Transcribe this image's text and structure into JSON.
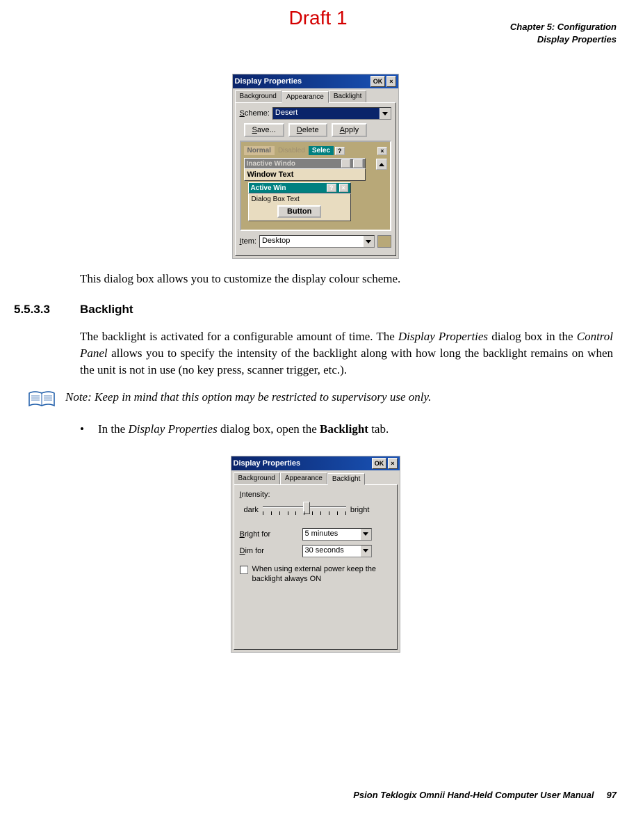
{
  "watermark": "Draft 1",
  "header": {
    "chapter": "Chapter 5: Configuration",
    "section": "Display Properties"
  },
  "shot1": {
    "title": "Display Properties",
    "ok": "OK",
    "close": "×",
    "tabs": {
      "bg": "Background",
      "app": "Appearance",
      "bl": "Backlight"
    },
    "scheme_lbl": "Scheme:",
    "scheme_val": "Desert",
    "btn_save": "Save...",
    "btn_delete": "Delete",
    "btn_apply": "Apply",
    "preview": {
      "normal": "Normal",
      "disabled": "Disabled",
      "selected": "Selec",
      "q": "?",
      "x": "×",
      "inactive": "Inactive Windo",
      "wintext": "Window Text",
      "active": "Active Win",
      "dlg": "Dialog Box Text",
      "button": "Button"
    },
    "item_lbl": "Item:",
    "item_val": "Desktop"
  },
  "para1": "This dialog box allows you to customize the display colour scheme.",
  "heading": {
    "num": "5.5.3.3",
    "title": "Backlight"
  },
  "para2_a": "The backlight is activated for a configurable amount of time. The ",
  "para2_b": "Display Properties",
  "para2_c": " dialog box in the ",
  "para2_d": "Control Panel",
  "para2_e": " allows you to specify the intensity of the backlight along with how long the backlight remains on when the unit is not in use (no key press, scanner trigger, etc.).",
  "note_prefix": "Note:",
  "note_text": " Keep in mind that this option may be restricted to supervisory use only.",
  "bullet_a": "In the ",
  "bullet_b": "Display Properties",
  "bullet_c": " dialog box, open the ",
  "bullet_d": "Backlight",
  "bullet_e": " tab.",
  "shot2": {
    "title": "Display Properties",
    "ok": "OK",
    "close": "×",
    "tabs": {
      "bg": "Background",
      "app": "Appearance",
      "bl": "Backlight"
    },
    "intensity": "Intensity:",
    "dark": "dark",
    "bright": "bright",
    "bright_for": "Bright for",
    "bright_val": "5 minutes",
    "dim_for": "Dim for",
    "dim_val": "30 seconds",
    "chk": "When using external power keep the backlight always ON"
  },
  "footer": {
    "text": "Psion Teklogix Omnii Hand-Held Computer User Manual",
    "page": "97"
  }
}
